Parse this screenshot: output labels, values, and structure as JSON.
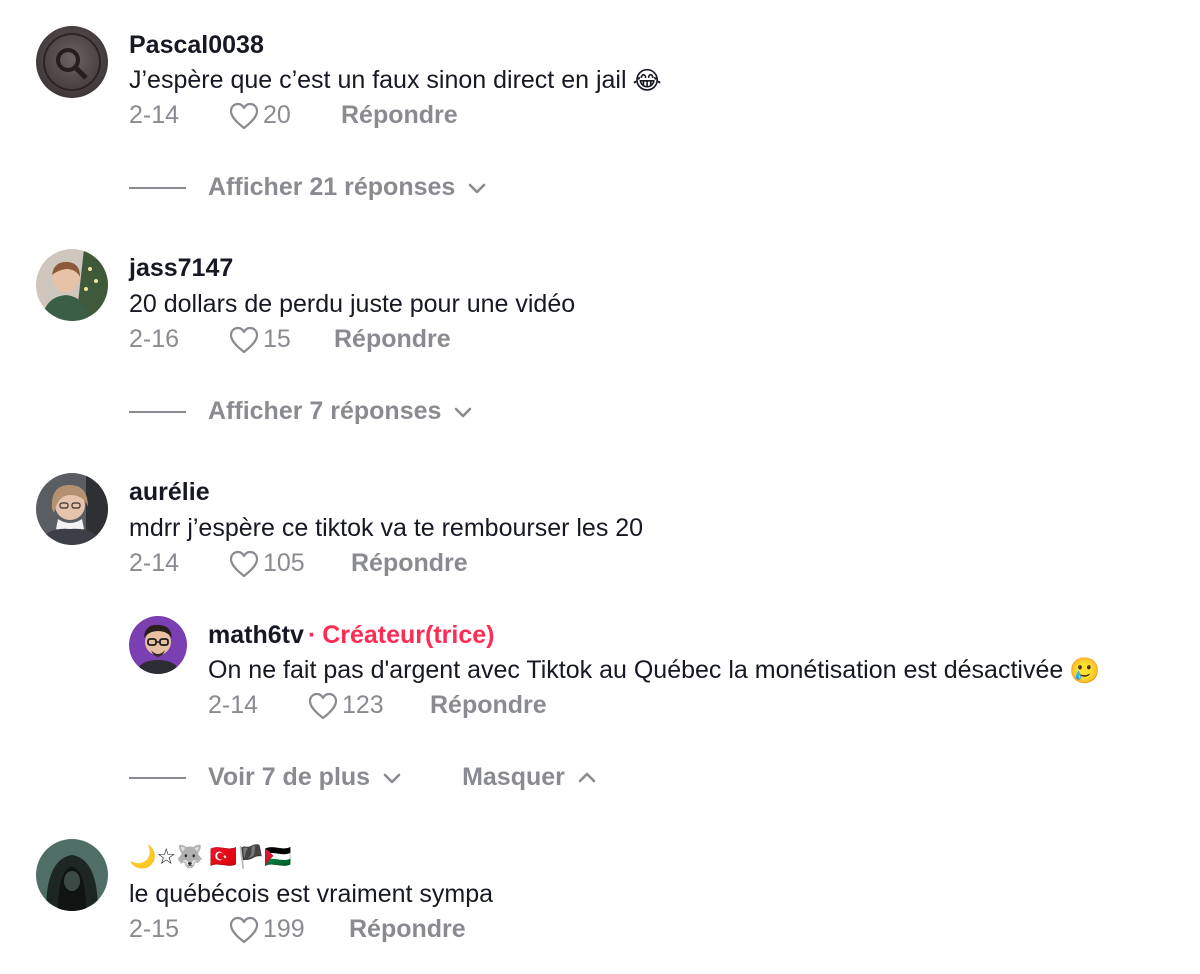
{
  "comments": [
    {
      "username": "Pascal0038",
      "text": "J’espère que c’est un faux sinon direct en jail",
      "emoji": "😂",
      "date": "2-14",
      "likes": "20",
      "reply_label": "Répondre",
      "thread_label": "Afficher 21 réponses"
    },
    {
      "username": "jass7147",
      "text": "20 dollars de perdu juste pour une vidéo",
      "date": "2-16",
      "likes": "15",
      "reply_label": "Répondre",
      "thread_label": "Afficher 7 réponses"
    },
    {
      "username": "aurélie",
      "text": "mdrr j’espère ce tiktok va te rembourser les 20",
      "date": "2-14",
      "likes": "105",
      "reply_label": "Répondre",
      "reply": {
        "username": "math6tv",
        "creator_dot": "·",
        "creator_label": "Créateur(trice)",
        "text": "On ne fait pas d'argent avec Tiktok au Québec la monétisation est désactivée",
        "emoji": "🥲",
        "date": "2-14",
        "likes": "123",
        "reply_label": "Répondre"
      },
      "more_label": "Voir 7 de plus",
      "hide_label": "Masquer"
    },
    {
      "username": "🌙☆🐺 🇹🇷🏴🇵🇸",
      "text": "le québécois est vraiment sympa",
      "date": "2-15",
      "likes": "199",
      "reply_label": "Répondre"
    }
  ],
  "colors": {
    "text": "#161823",
    "muted": "#8a8b91",
    "creator": "#fe2c55"
  },
  "icons": {
    "like": "heart-outline-icon",
    "expand": "chevron-down-icon",
    "collapse": "chevron-up-icon"
  }
}
